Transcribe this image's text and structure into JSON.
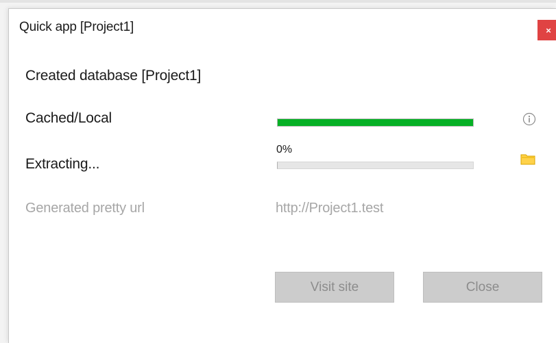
{
  "dialog": {
    "title": "Quick app [Project1]",
    "close_glyph": "×"
  },
  "status": {
    "created_label": "Created database [Project1]",
    "cached_label": "Cached/Local",
    "cached_progress": 1.0,
    "extracting_label": "Extracting...",
    "extract_percent_text": "0%",
    "extract_progress": 0.0,
    "pretty_url_label": "Generated pretty url",
    "pretty_url_value": "http://Project1.test"
  },
  "icons": {
    "info": "info-icon",
    "folder": "folder-icon"
  },
  "buttons": {
    "visit_label": "Visit site",
    "close_label": "Close"
  },
  "colors": {
    "progress_fill": "#06b025",
    "close_bg": "#e04343",
    "folder": "#ffd24a"
  }
}
